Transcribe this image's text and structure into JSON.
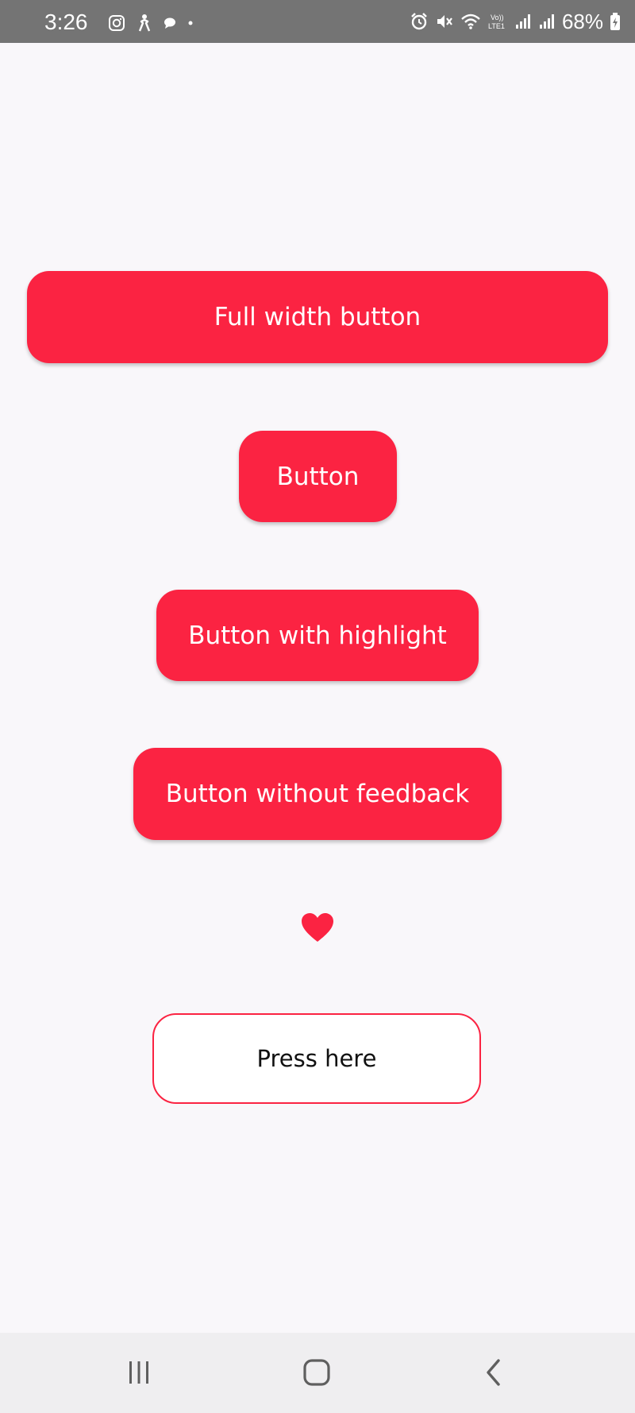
{
  "status_bar": {
    "time": "3:26",
    "battery": "68%",
    "left_icons": [
      "instagram-icon",
      "accessibility-icon",
      "chat-bubble-icon",
      "dot-icon"
    ],
    "right_icons": [
      "alarm-icon",
      "mute-icon",
      "wifi-icon",
      "volte-icon",
      "signal-icon",
      "signal-icon-2",
      "battery-icon"
    ]
  },
  "buttons": {
    "full_width": "Full width button",
    "button": "Button",
    "highlight": "Button with highlight",
    "no_feedback": "Button without feedback",
    "press_here": "Press here"
  },
  "icons": {
    "heart": "heart-icon"
  },
  "colors": {
    "accent": "#fb2342",
    "background": "#f9f7fa",
    "status_bar": "#747474",
    "nav_bar": "#efeef0"
  },
  "nav_bar": {
    "items": [
      "recents",
      "home",
      "back"
    ]
  }
}
